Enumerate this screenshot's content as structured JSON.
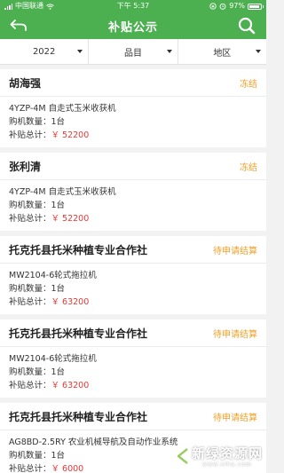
{
  "status_bar": {
    "carrier": "中国联通",
    "time": "下午 5:37",
    "battery": "97%"
  },
  "header": {
    "title": "补贴公示",
    "back_icon": "back-arrow-icon",
    "search_icon": "search-icon",
    "accent_color": "#4caf50"
  },
  "filters": [
    {
      "label": "2022"
    },
    {
      "label": "品目"
    },
    {
      "label": "地区"
    }
  ],
  "records": [
    {
      "name": "胡海强",
      "status": "冻结",
      "model": "4YZP-4M 自走式玉米收获机",
      "qty_label": "购机数量：",
      "qty": "1台",
      "subsidy_label": "补贴总计：",
      "subsidy": "￥ 52200"
    },
    {
      "name": "张利清",
      "status": "冻结",
      "model": "4YZP-4M 自走式玉米收获机",
      "qty_label": "购机数量：",
      "qty": "1台",
      "subsidy_label": "补贴总计：",
      "subsidy": "￥ 52200"
    },
    {
      "name": "托克托县托米种植专业合作社",
      "status": "待申请结算",
      "model": "MW2104-6轮式拖拉机",
      "qty_label": "购机数量：",
      "qty": "1台",
      "subsidy_label": "补贴总计：",
      "subsidy": "￥ 63200"
    },
    {
      "name": "托克托县托米种植专业合作社",
      "status": "待申请结算",
      "model": "MW2104-6轮式拖拉机",
      "qty_label": "购机数量：",
      "qty": "1台",
      "subsidy_label": "补贴总计：",
      "subsidy": "￥ 63200"
    },
    {
      "name": "托克托县托米种植专业合作社",
      "status": "待申请结算",
      "model": "AG8BD-2.5RY 农业机械导航及自动作业系统",
      "qty_label": "购机数量：",
      "qty": "1台",
      "subsidy_label": "补贴总计：",
      "subsidy": "￥ 6000"
    }
  ],
  "watermark": {
    "text": "新绿资源网",
    "sub": "www.xiha.com"
  }
}
